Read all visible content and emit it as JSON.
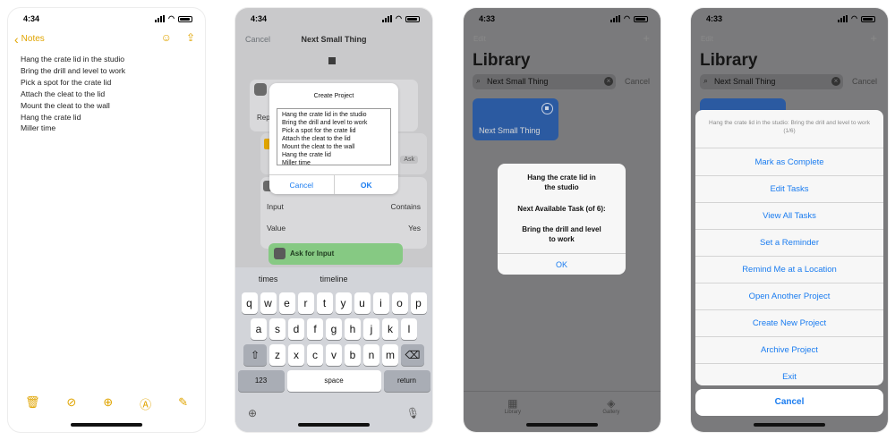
{
  "screens": {
    "notes": {
      "time": "4:34",
      "back_label": "Notes",
      "lines": [
        "Hang the crate lid in the studio",
        "Bring the drill and level to work",
        "Pick a spot for the crate lid",
        "Attach the cleat to the lid",
        "Mount the cleat to the wall",
        "Hang the crate lid",
        "Miller time"
      ],
      "accent": "#e0a400"
    },
    "create": {
      "time": "4:34",
      "nav_cancel": "Cancel",
      "nav_title": "Next Small Thing",
      "bg_rep": "Rep",
      "bg_ask": "Ask",
      "bg_input_label": "Input",
      "bg_input_value": "Contains",
      "bg_value_label": "Value",
      "bg_value_value": "Yes",
      "ask_for_input": "Ask for Input",
      "dialog": {
        "title": "Create Project",
        "lines": [
          "Hang the crate lid in the studio",
          "Bring the drill and level to work",
          "Pick a spot for the crate lid",
          "Attach the cleat to the lid",
          "Mount the cleat to the wall",
          "Hang the crate lid",
          "Miller time"
        ],
        "cancel": "Cancel",
        "ok": "OK"
      },
      "keyboard": {
        "suggestions": [
          "times",
          "timeline",
          ""
        ],
        "row1": [
          "q",
          "w",
          "e",
          "r",
          "t",
          "y",
          "u",
          "i",
          "o",
          "p"
        ],
        "row2": [
          "a",
          "s",
          "d",
          "f",
          "g",
          "h",
          "j",
          "k",
          "l"
        ],
        "row3": [
          "z",
          "x",
          "c",
          "v",
          "b",
          "n",
          "m"
        ],
        "numbers": "123",
        "space": "space",
        "return": "return"
      }
    },
    "library_alert": {
      "time": "4:33",
      "edit": "Edit",
      "title": "Library",
      "search": "Next Small Thing",
      "cancel": "Cancel",
      "tile": "Next Small Thing",
      "alert": {
        "line1": "Hang the crate lid in",
        "line2": "the studio",
        "line3": "Next Available Task (of 6):",
        "line4": "Bring the drill and level",
        "line5": "to work",
        "ok": "OK"
      },
      "tabs": [
        "Library",
        "Gallery"
      ]
    },
    "library_sheet": {
      "time": "4:33",
      "edit": "Edit",
      "title": "Library",
      "search": "Next Small Thing",
      "cancel": "Cancel",
      "header": "Hang the crate lid in the studio: Bring the drill and level to work (1/6)",
      "actions": [
        "Mark as Complete",
        "Edit Tasks",
        "View All Tasks",
        "Set a Reminder",
        "Remind Me at a Location",
        "Open Another Project",
        "Create New Project",
        "Archive Project",
        "Exit"
      ],
      "sheet_cancel": "Cancel"
    }
  }
}
